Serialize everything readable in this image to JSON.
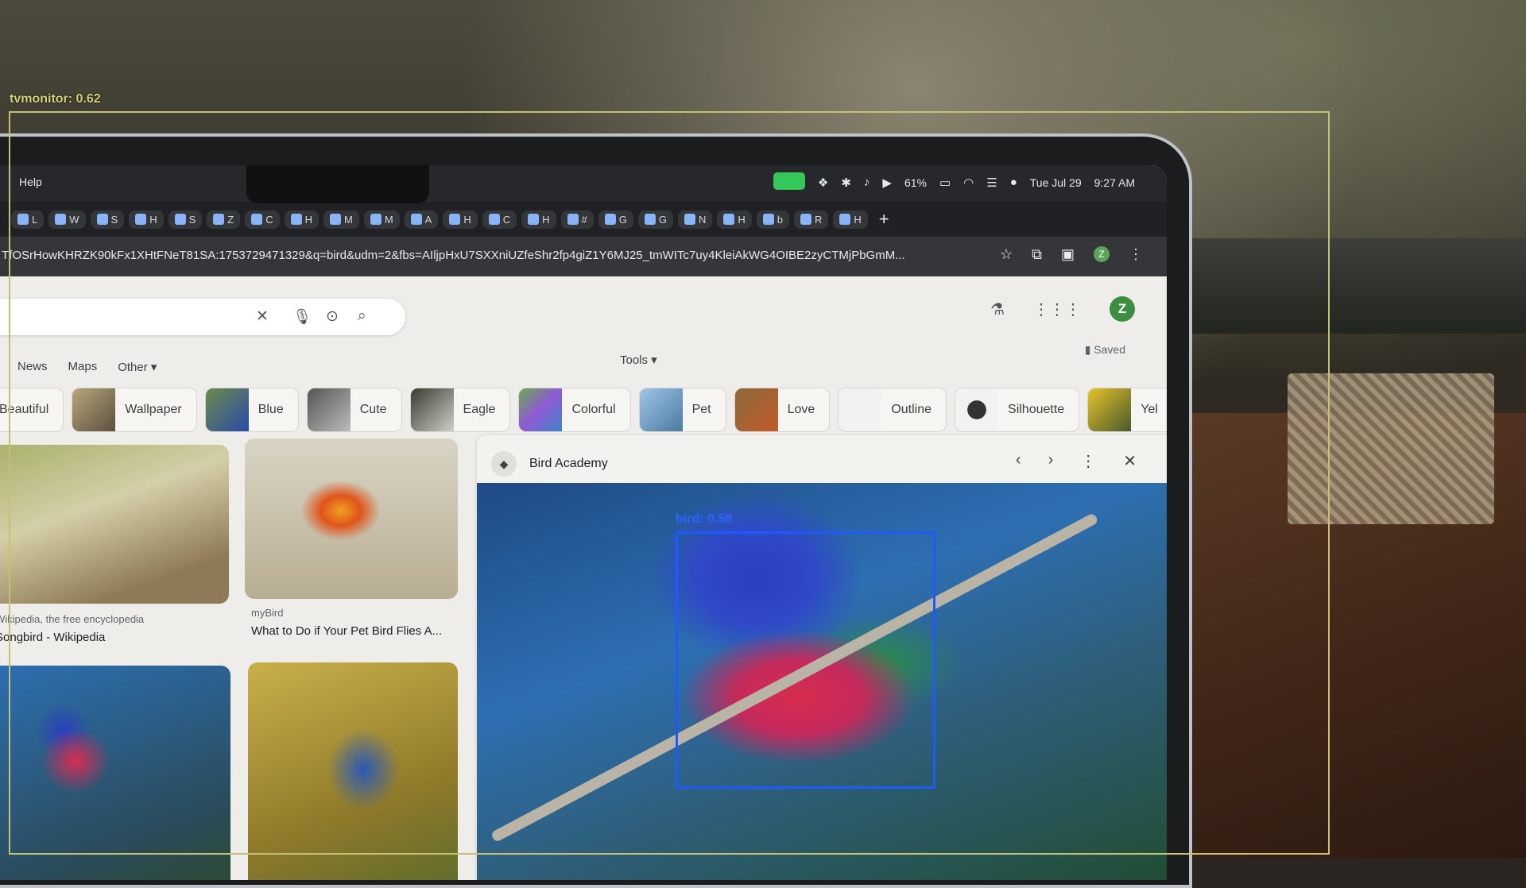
{
  "overlay": {
    "monitor_label": "tvmonitor: 0.62",
    "bird_label": "bird: 0.58"
  },
  "menubar": {
    "help": "Help",
    "battery": "61%",
    "date": "Tue Jul 29",
    "time": "9:27 AM"
  },
  "tabs": [
    {
      "label": "L"
    },
    {
      "label": "W"
    },
    {
      "label": "S"
    },
    {
      "label": "H"
    },
    {
      "label": "S"
    },
    {
      "label": "Z"
    },
    {
      "label": "C"
    },
    {
      "label": "H"
    },
    {
      "label": "M"
    },
    {
      "label": "M"
    },
    {
      "label": "A"
    },
    {
      "label": "H"
    },
    {
      "label": "C"
    },
    {
      "label": "H"
    },
    {
      "label": "#"
    },
    {
      "label": "G"
    },
    {
      "label": "G"
    },
    {
      "label": "N"
    },
    {
      "label": "H"
    },
    {
      "label": "b"
    },
    {
      "label": "R"
    },
    {
      "label": "H"
    }
  ],
  "omnibox": {
    "url": "TfOSrHowKHRZK90kFx1XHtFNeT81SA:1753729471329&q=bird&udm=2&fbs=AIljpHxU7SXXniUZfeShr2fp4giZ1Y6MJ25_tmWITc7uy4KleiAkWG4OIBE2zyCTMjPbGmM..."
  },
  "google": {
    "avatar_letter": "Z",
    "tabs": [
      "News",
      "Maps",
      "Other ▾"
    ],
    "tools": "Tools ▾",
    "saved": "Saved",
    "chips": [
      "Beautiful",
      "Wallpaper",
      "Blue",
      "Cute",
      "Eagle",
      "Colorful",
      "Pet",
      "Love",
      "Outline",
      "Silhouette",
      "Yel"
    ],
    "results": [
      {
        "source": "Wikipedia, the free encyclopedia",
        "title": "Songbird - Wikipedia"
      },
      {
        "source": "myBird",
        "title": "What to Do if Your Pet Bird Flies A..."
      }
    ],
    "preview": {
      "site": "Bird Academy"
    }
  },
  "colors": {
    "monitor_box": "#c6c076",
    "bird_box": "#1e5bff",
    "avatar": "#3e8e41"
  }
}
